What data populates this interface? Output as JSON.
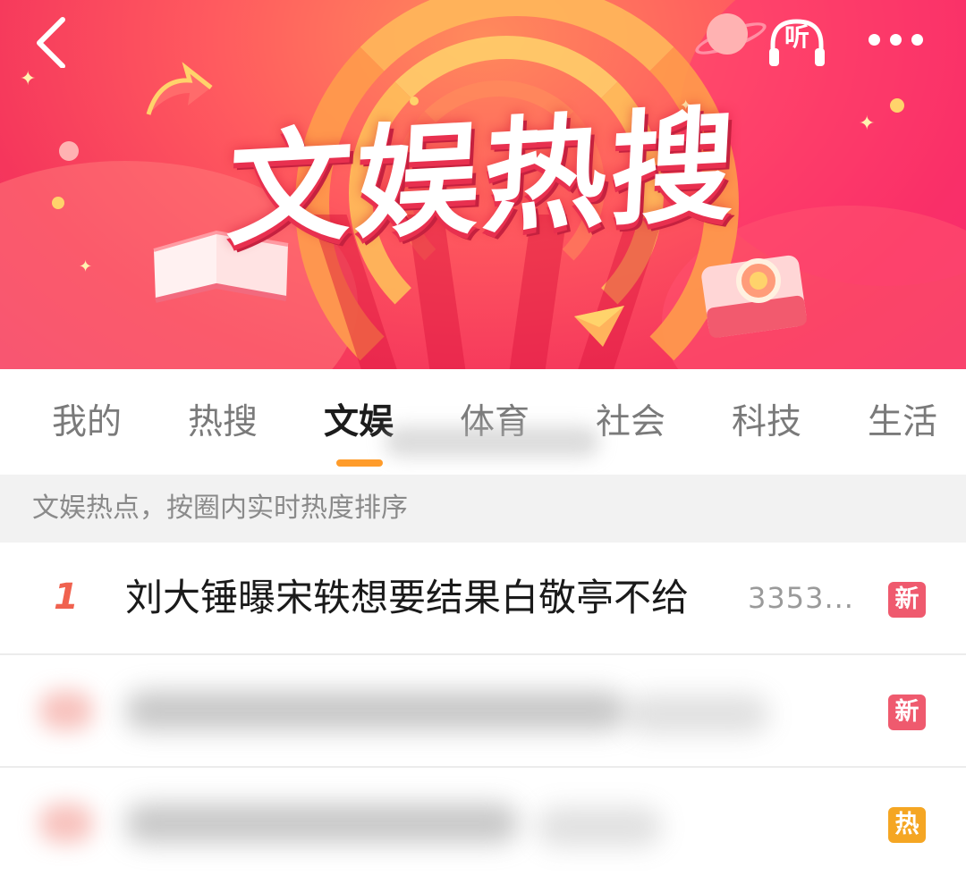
{
  "banner": {
    "title": "文娱热搜",
    "listen_label": "听",
    "colors": {
      "gradient_start": "#ff8a5c",
      "gradient_end": "#ef2d6a",
      "title_shadow": "#e8304f"
    }
  },
  "header": {
    "back_icon": "back-chevron-icon",
    "listen_icon": "headphones-icon",
    "more_icon": "more-dots-icon"
  },
  "tabs": [
    {
      "label": "我的",
      "active": false
    },
    {
      "label": "热搜",
      "active": false
    },
    {
      "label": "文娱",
      "active": true
    },
    {
      "label": "体育",
      "active": false
    },
    {
      "label": "社会",
      "active": false
    },
    {
      "label": "科技",
      "active": false
    },
    {
      "label": "生活",
      "active": false
    }
  ],
  "info_bar": {
    "text": "文娱热点，按圈内实时热度排序"
  },
  "list": [
    {
      "rank": "1",
      "title": "刘大锤曝宋轶想要结果白敬亭不给",
      "count": "3353...",
      "badge": "新",
      "badge_type": "new"
    },
    {
      "rank": "2",
      "title": "",
      "count": "",
      "badge": "新",
      "badge_type": "new"
    },
    {
      "rank": "3",
      "title": "",
      "count": "",
      "badge": "热",
      "badge_type": "hot"
    }
  ],
  "accent": {
    "tab_underline": "#ff9c2b",
    "rank_color": "#f0624f",
    "badge_new": "#ef5a6e",
    "badge_hot": "#f5a623"
  }
}
